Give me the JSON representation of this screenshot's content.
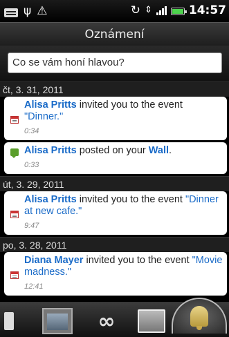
{
  "status_bar": {
    "icons": [
      "message-icon",
      "usb-icon",
      "warning-icon",
      "sync-icon",
      "data-icon",
      "signal-icon",
      "battery-icon"
    ],
    "time": "14:57"
  },
  "header": {
    "title": "Oznámení"
  },
  "search": {
    "placeholder": "Co se vám honí hlavou?"
  },
  "groups": [
    {
      "date": "čt, 3. 31, 2011",
      "items": [
        {
          "icon": "calendar-icon",
          "name": "Alisa Pritts",
          "text": " invited you to the event ",
          "link": "\"Dinner.\"",
          "time": "0:34"
        },
        {
          "icon": "wall-post-icon",
          "name": "Alisa Pritts",
          "text": " posted on your ",
          "link": "Wall",
          "suffix": ".",
          "time": "0:33"
        }
      ]
    },
    {
      "date": "út, 3. 29, 2011",
      "items": [
        {
          "icon": "calendar-icon",
          "name": "Alisa Pritts",
          "text": " invited you to the event ",
          "link": "\"Dinner at new cafe.\"",
          "time": "9:47"
        }
      ]
    },
    {
      "date": "po, 3. 28, 2011",
      "items": [
        {
          "icon": "calendar-icon",
          "name": "Diana Mayer",
          "text": " invited you to the event ",
          "link": "\"Movie madness.\"",
          "time": "12:41"
        }
      ]
    }
  ],
  "bottom_bar": {
    "items": [
      "side-tab-icon",
      "videos-icon",
      "links-icon",
      "photos-icon",
      "notifications-bell-icon"
    ],
    "active": "notifications-bell-icon"
  },
  "colors": {
    "link": "#1a6bc8",
    "battery": "#4dd34d"
  }
}
